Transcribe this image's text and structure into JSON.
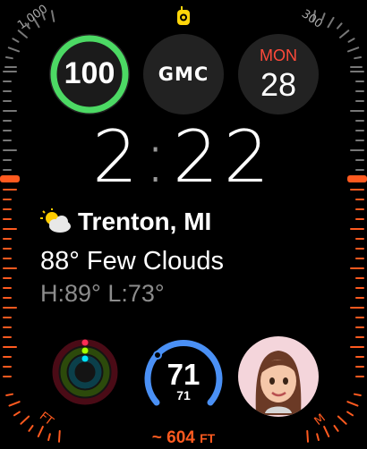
{
  "bezel": {
    "top_left_label": "1,000",
    "top_right_label": "300",
    "bottom_left_label": "FT",
    "bottom_right_label": "M",
    "accent_color": "#ff5a1f"
  },
  "status": {
    "icon": "walkie-talkie-icon",
    "color": "#ffd60a"
  },
  "complications": {
    "ring": {
      "value": "100",
      "color": "#4cd964"
    },
    "gmc": {
      "logo_text": "GMC"
    },
    "calendar": {
      "weekday": "MON",
      "day": "28"
    }
  },
  "time": {
    "hours": "2",
    "minutes": "22"
  },
  "weather": {
    "icon": "partly-cloudy-icon",
    "location": "Trenton, MI",
    "condition": "88° Few Clouds",
    "hi_lo": "H:89° L:73°"
  },
  "activity": {
    "icon": "activity-rings-icon"
  },
  "temperature_gauge": {
    "current": "71",
    "sub": "71",
    "color": "#4a90f5"
  },
  "memoji": {
    "icon": "memoji-avatar"
  },
  "elevation": {
    "prefix": "~",
    "value": "604",
    "unit": "FT"
  }
}
